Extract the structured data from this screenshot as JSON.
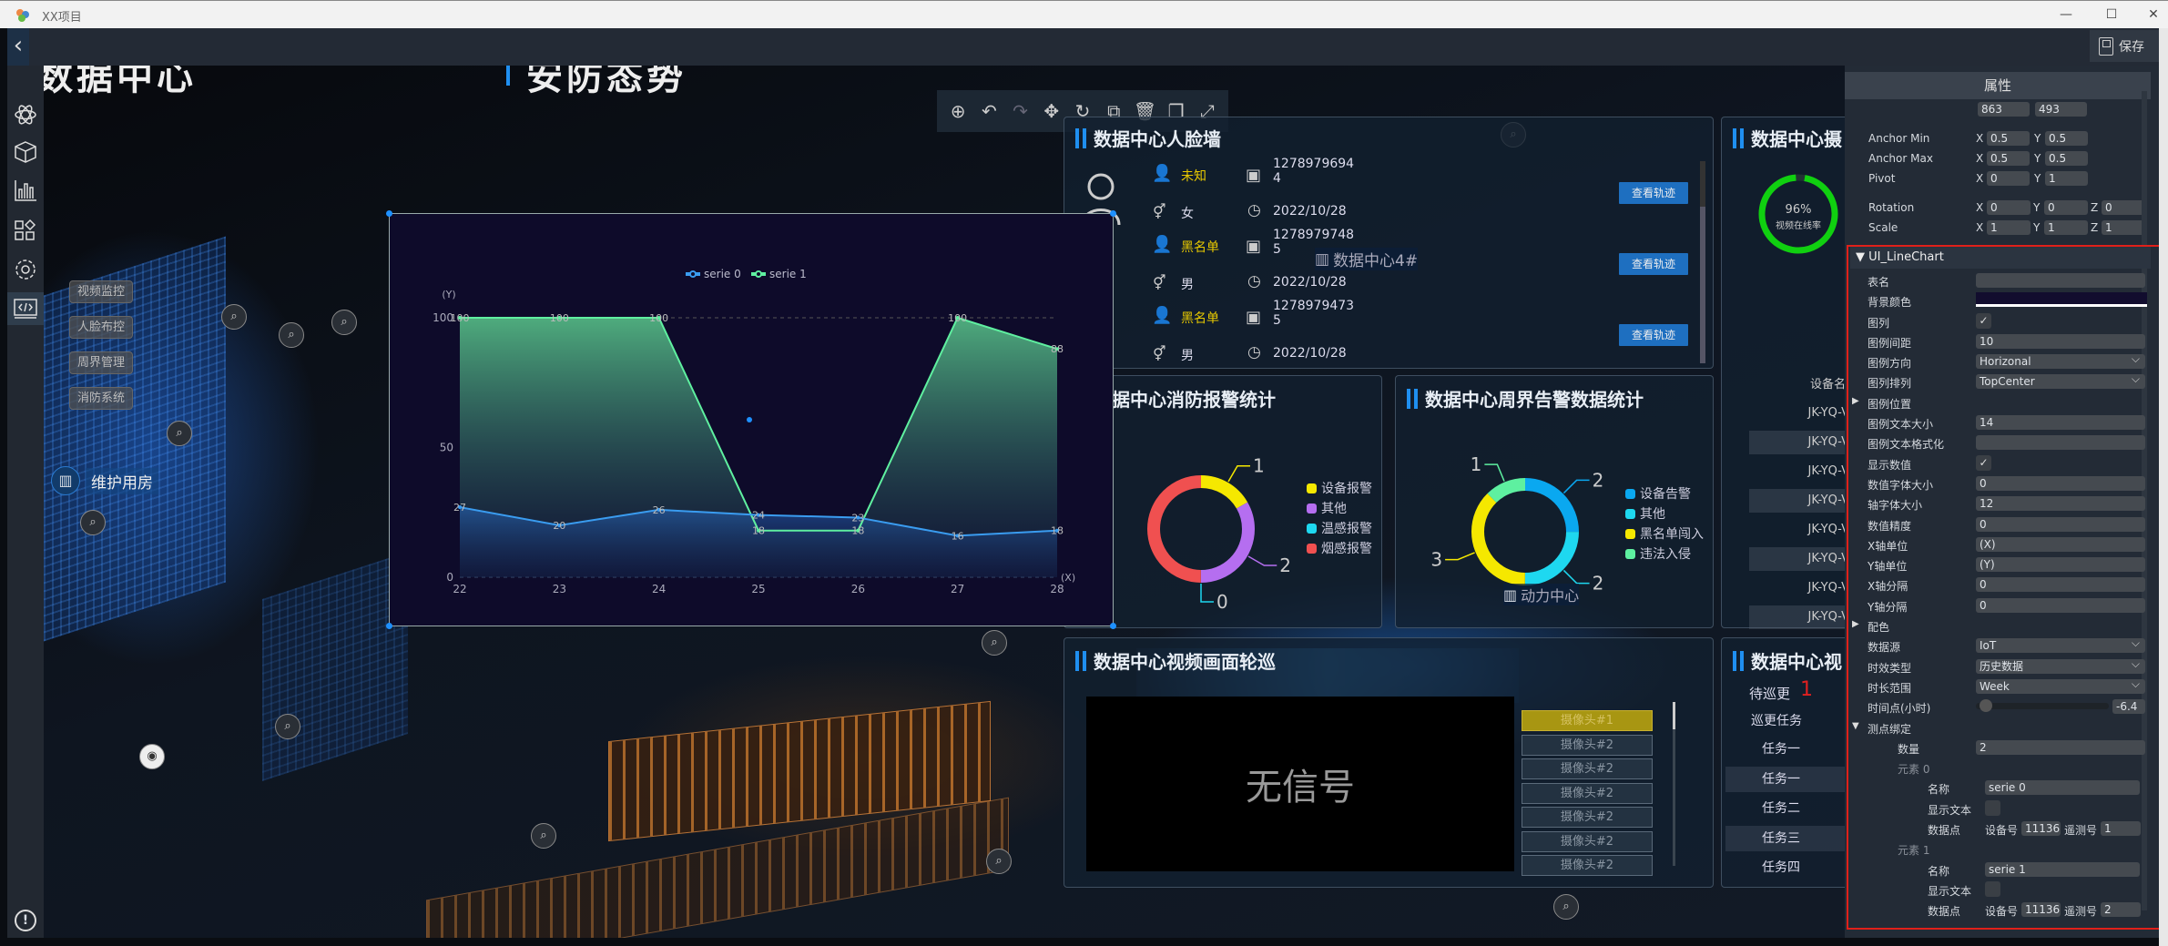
{
  "window": {
    "title": "XX项目",
    "controls": [
      "—",
      "☐",
      "✕"
    ]
  },
  "toolbar": {
    "back": "‹",
    "save_label": "保存"
  },
  "scene": {
    "title_left": "数据中心",
    "title_right": "安防态势",
    "submenu": [
      "视频监控",
      "人脸布控",
      "周界管理",
      "消防系统"
    ],
    "building_label": "维护用房",
    "label_4": "数据中心4#",
    "label_power": "动力中心"
  },
  "floating_toolbar": [
    "locate-icon",
    "undo-icon",
    "redo-icon",
    "move-icon",
    "rotate-icon",
    "external-icon",
    "delete-icon",
    "copy-icon",
    "fullscreen-icon"
  ],
  "face_wall": {
    "title": "数据中心人脸墙",
    "entries": [
      {
        "type": "未知",
        "id": "1278979694\n4",
        "gender": "女",
        "date": "2022/10/28",
        "button": "查看轨迹"
      },
      {
        "type": "黑名单",
        "id": "1278979748\n5",
        "gender": "男",
        "date": "2022/10/28",
        "button": "查看轨迹"
      },
      {
        "type": "黑名单",
        "id": "1278979473\n5",
        "gender": "男",
        "date": "2022/10/28",
        "button": "查看轨迹"
      }
    ]
  },
  "fire_panel": {
    "title": "数据中心消防报警统计"
  },
  "perimeter_panel": {
    "title": "数据中心周界告警数据统计"
  },
  "video_panel": {
    "title": "数据中心视频画面轮巡",
    "no_signal": "无信号",
    "cameras": [
      "摄像头#1",
      "摄像头#2",
      "摄像头#2",
      "摄像头#2",
      "摄像头#2",
      "摄像头#2",
      "摄像头#2"
    ]
  },
  "camera_panel": {
    "title": "数据中心摄",
    "rate": "96%",
    "rate_label": "视频在线率",
    "rate_value": 96,
    "col_header": "设备名",
    "devices": [
      "JK-YQ-V",
      "JK-YQ-V",
      "JK-YQ-V",
      "JK-YQ-V",
      "JK-YQ-V",
      "JK-YQ-V",
      "JK-YQ-V",
      "JK-YQ-V"
    ]
  },
  "patrol_panel": {
    "title": "数据中心视",
    "pending": "待巡更",
    "pending_count": "1",
    "tasks_title": "巡更任务",
    "tasks": [
      "任务一",
      "任务一",
      "任务二",
      "任务三",
      "任务四"
    ]
  },
  "properties": {
    "title": "属性",
    "size": [
      "863",
      "493"
    ],
    "anchor_min": {
      "label": "Anchor Min",
      "x": "0.5",
      "y": "0.5"
    },
    "anchor_max": {
      "label": "Anchor Max",
      "x": "0.5",
      "y": "0.5"
    },
    "pivot": {
      "label": "Pivot",
      "x": "0",
      "y": "1"
    },
    "rotation": {
      "label": "Rotation",
      "x": "0",
      "y": "0",
      "z": "0"
    },
    "scale": {
      "label": "Scale",
      "x": "1",
      "y": "1",
      "z": "1"
    },
    "component": "UI_LineChart",
    "bg_color": "#120d2e",
    "rows": [
      {
        "label": "表名",
        "type": "text",
        "value": ""
      },
      {
        "label": "背景颜色",
        "type": "color",
        "value": ""
      },
      {
        "label": "图列",
        "type": "check",
        "value": "✓"
      },
      {
        "label": "图例间距",
        "type": "text",
        "value": "10"
      },
      {
        "label": "图例方向",
        "type": "select",
        "value": "Horizonal"
      },
      {
        "label": "图列排列",
        "type": "select",
        "value": "TopCenter"
      },
      {
        "label": "图例位置",
        "type": "group",
        "value": "▶"
      },
      {
        "label": "图例文本大小",
        "type": "text",
        "value": "14"
      },
      {
        "label": "图例文本格式化",
        "type": "text",
        "value": ""
      },
      {
        "label": "显示数值",
        "type": "check",
        "value": "✓"
      },
      {
        "label": "数值字体大小",
        "type": "text",
        "value": "0"
      },
      {
        "label": "轴字体大小",
        "type": "text",
        "value": "12"
      },
      {
        "label": "数值精度",
        "type": "text",
        "value": "0"
      },
      {
        "label": "X轴单位",
        "type": "text",
        "value": "(X)"
      },
      {
        "label": "Y轴单位",
        "type": "text",
        "value": "(Y)"
      },
      {
        "label": "X轴分隔",
        "type": "text",
        "value": "0"
      },
      {
        "label": "Y轴分隔",
        "type": "text",
        "value": "0"
      },
      {
        "label": "配色",
        "type": "group",
        "value": "▶"
      },
      {
        "label": "数据源",
        "type": "select",
        "value": "IoT"
      },
      {
        "label": "时效类型",
        "type": "select",
        "value": "历史数据"
      },
      {
        "label": "时长范围",
        "type": "select",
        "value": "Week"
      },
      {
        "label": "时间点(小时)",
        "type": "slider",
        "value": "-6.4"
      },
      {
        "label": "测点绑定",
        "type": "group",
        "value": "▼"
      },
      {
        "label": "数量",
        "type": "text",
        "value": "2",
        "indent": 1
      },
      {
        "label": "元素 0",
        "type": "heading",
        "value": "",
        "indent": 1
      },
      {
        "label": "名称",
        "type": "text",
        "value": "serie 0",
        "indent": 2
      },
      {
        "label": "显示文本",
        "type": "check",
        "value": "",
        "indent": 2
      },
      {
        "label": "数据点",
        "type": "point",
        "value": "",
        "device_label": "设备号",
        "device": "11136",
        "tele_label": "遥测号",
        "tele": "1",
        "indent": 2
      },
      {
        "label": "元素 1",
        "type": "heading",
        "value": "",
        "indent": 1
      },
      {
        "label": "名称",
        "type": "text",
        "value": "serie 1",
        "indent": 2
      },
      {
        "label": "显示文本",
        "type": "check",
        "value": "",
        "indent": 2
      },
      {
        "label": "数据点",
        "type": "point",
        "value": "",
        "device_label": "设备号",
        "device": "11136",
        "tele_label": "遥测号",
        "tele": "2",
        "indent": 2
      }
    ]
  },
  "colors": {
    "serie0": "#3a9cf0",
    "serie1": "#5ff0a0",
    "accent": "#1f8ff0",
    "highlight": "#e0201a"
  },
  "chart_data": [
    {
      "type": "line",
      "title": "",
      "x": [
        "22",
        "23",
        "24",
        "25",
        "26",
        "27",
        "28"
      ],
      "series": [
        {
          "name": "serie 0",
          "values": [
            27,
            20,
            26,
            24,
            23,
            16,
            18
          ]
        },
        {
          "name": "serie 1",
          "values": [
            100,
            100,
            100,
            18,
            18,
            100,
            88
          ]
        }
      ],
      "xlabel": "(X)",
      "ylabel": "(Y)",
      "ylim": [
        0,
        100
      ],
      "yticks": [
        "0",
        "50",
        "100"
      ],
      "legend": "top-center",
      "area": true,
      "data_labels": true
    },
    {
      "type": "pie",
      "title": "数据中心消防报警统计",
      "donut": true,
      "categories": [
        "设备报警",
        "其他",
        "温感报警",
        "烟感报警"
      ],
      "values": [
        1,
        2,
        0,
        3
      ],
      "labels": [
        "1",
        "2",
        "0",
        ""
      ],
      "colors": [
        "#f5e800",
        "#b56ef0",
        "#1ed8f0",
        "#f05050"
      ]
    },
    {
      "type": "pie",
      "title": "数据中心周界告警数据统计",
      "donut": true,
      "categories": [
        "设备告警",
        "其他",
        "黑名单闯入",
        "违法入侵"
      ],
      "values": [
        2,
        2,
        3,
        1
      ],
      "labels": [
        "2",
        "2",
        "3",
        "1"
      ],
      "colors": [
        "#0aa8f0",
        "#1ed8f0",
        "#f5e800",
        "#5ef0a0"
      ]
    }
  ]
}
